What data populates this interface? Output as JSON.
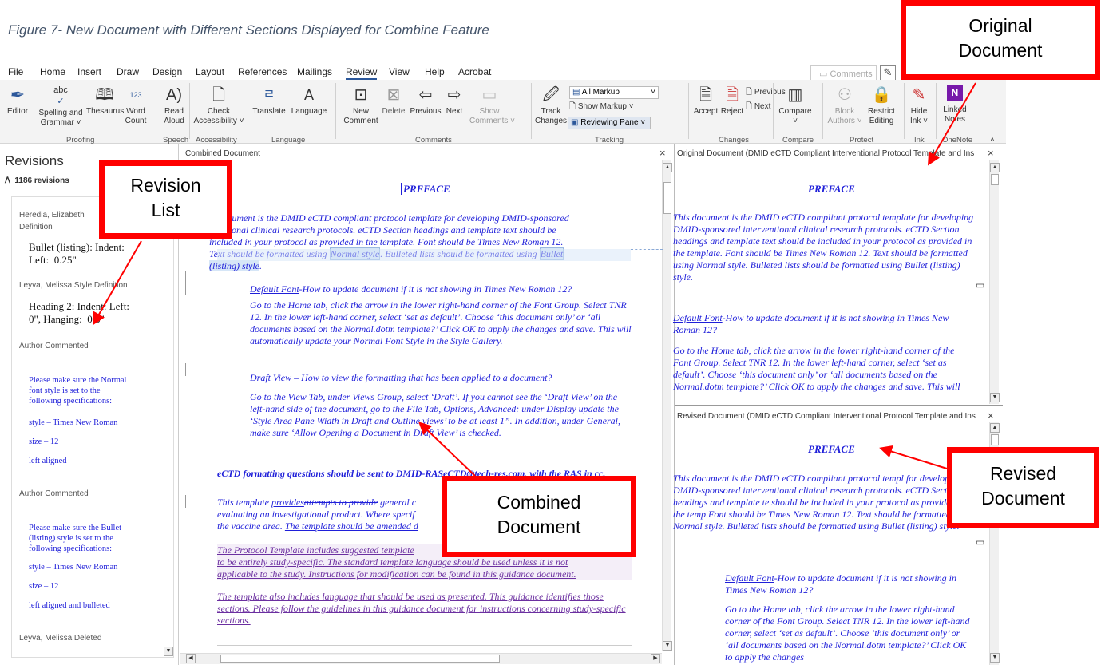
{
  "caption": "Figure 7- New Document with Different Sections Displayed for Combine Feature",
  "menu": [
    "File",
    "Home",
    "Insert",
    "Draw",
    "Design",
    "Layout",
    "References",
    "Mailings",
    "Review",
    "View",
    "Help",
    "Acrobat"
  ],
  "menu_active": "Review",
  "comments_button": "Comments",
  "ribbon": {
    "buttons": {
      "editor": "Editor",
      "spelling": "Spelling and\nGrammar ˅",
      "thesaurus": "Thesaurus",
      "wordcount": "Word\nCount",
      "readaloud": "Read\nAloud",
      "checkacc": "Check\nAccessibility ˅",
      "translate": "Translate",
      "language": "Language",
      "newcomment": "New\nComment",
      "delete": "Delete",
      "previous": "Previous",
      "next": "Next",
      "showcomments": "Show\nComments ˅",
      "track": "Track\nChanges ˅",
      "allmarkup": "All Markup",
      "showmarkup": "Show Markup ˅",
      "reviewingpane": "Reviewing Pane ˅",
      "accept": "Accept",
      "reject": "Reject",
      "chg_previous": "Previous",
      "chg_next": "Next",
      "compare": "Compare",
      "blockauthors": "Block\nAuthors ˅",
      "restrict": "Restrict\nEditing",
      "hideink": "Hide\nInk ˅",
      "linkednotes": "Linked\nNotes",
      "abc": "abc",
      "num123": "123"
    },
    "groups": [
      "Proofing",
      "Speech",
      "Accessibility",
      "Language",
      "Comments",
      "Tracking",
      "Changes",
      "Compare",
      "Protect",
      "Ink",
      "OneNote"
    ]
  },
  "revisions": {
    "title": "Revisions",
    "count": "1186 revisions",
    "items": [
      {
        "author": "Heredia, Elizabeth",
        "kind": "Definition",
        "detail": "Bullet (listing): Indent:\nLeft:  0.25\""
      },
      {
        "author": "Leyva, Melissa Style Definition",
        "detail": "Heading 2: Indent: Left:\n0\", Hanging:  0.5\""
      },
      {
        "author": "Author Commented",
        "lines": [
          "Please make sure the Normal\nfont style is set to the\nfollowing specifications:",
          "style – Times New Roman",
          "size – 12",
          "left aligned"
        ]
      },
      {
        "author": "Author Commented",
        "lines": [
          "Please make sure the Bullet\n(listing) style is set to the\nfollowing specifications:",
          "style – Times New Roman",
          "size – 12",
          "left aligned and bulleted"
        ]
      },
      {
        "author": "Leyva, Melissa Deleted"
      }
    ]
  },
  "combined": {
    "header": "Combined Document",
    "heading": "PREFACE",
    "p1_a": "is document is the DMID eCTD compliant protocol template for developing DMID-sponsored",
    "p1_b": "rventional clinical research protocols. eCTD Section headings and template text should be",
    "p1_c": "included in your protocol as provided in the template. Font should be Times New Roman 12.",
    "p1_d1": "Text should be formatted using ",
    "p1_d2": "Normal style",
    "p1_d3": ". Bulleted lists should be formatted using ",
    "p1_d4": "Bullet",
    "p1_e": "(listing) style",
    "p1_e2": ".",
    "sub1_link": "Default Font",
    "sub1": "-How to update document if it is not showing in Times New Roman 12?",
    "p2": "Go to the Home tab, click the arrow in the lower right-hand corner of the Font Group. Select TNR 12.  In the lower left-hand corner, select ‘set as default’.  Choose ‘this document only’ or ‘all documents based on the Normal.dotm template?’ Click OK to apply the changes and save.  This will automatically update your Normal Font Style in the Style Gallery.",
    "sub2_link": "Draft View",
    "sub2": " – How to view the formatting that has been applied to a document?",
    "p3": "Go to the View Tab, under Views Group, select ‘Draft’.  If you cannot see the ‘Draft View’ on the left-hand side of the document, go to the File Tab, Options, Advanced: under Display update the ‘Style Area Pane Width in Draft and Outline views’ to be at least 1”.  In addition, under General, make sure ‘Allow Opening a Document in Draft View’ is checked.",
    "bold": "eCTD formatting questions should be sent to DMID-RASeCTD@tech-res.com, with the RAS in cc.",
    "p4_a": "This template ",
    "p4_ins": "provides",
    "p4_del": "attempts to provide",
    "p4_b": " general c",
    "p4_c": "evaluating an investigational product. Where specif",
    "p4_d": "the vaccine area. ",
    "p4_e": "The template should be amended d",
    "p5_a": "The Protocol Template includes suggested template",
    "p5_b": "to be entirely study-specific.  The standard template language should be used unless it is not",
    "p5_c": "applicable to the study.  Instructions for modification can be found in this guidance document.",
    "p6": "The template also includes language that should be used as presented.  This guidance identifies those sections.  Please follow the guidelines in this guidance document for instructions concerning study-specific sections."
  },
  "original": {
    "header": "Original Document (DMID eCTD Compliant Interventional Protocol Template and Ins",
    "heading": "PREFACE",
    "p1": "This document is the DMID eCTD compliant protocol template for developing DMID-sponsored interventional clinical research protocols. eCTD Section headings and template text should be included in your protocol as provided in the template. Font should be Times New Roman 12.  Text should be formatted using Normal style. Bulleted lists should be formatted using Bullet (listing) style.",
    "sub_link": "Default Font",
    "sub": "-How to update document if it is not showing in Times New Roman 12?",
    "p2": " Go to the Home tab, click the arrow in the lower right-hand corner of the Font Group.  Select TNR 12.  In the lower left-hand corner, select ‘set as default’.  Choose ‘this document only’ or ‘all documents based on the Normal.dotm template?’ Click OK to apply the changes and save.  This will"
  },
  "revised": {
    "header": "Revised Document (DMID eCTD Compliant Interventional Protocol Template and Ins",
    "heading": "PREFACE",
    "p1": "This document is the DMID eCTD compliant protocol templ for developing DMID-sponsored interventional clinical research protocols. eCTD Section headings and template te should be included in your protocol as provided in the temp Font should be Times New Roman 12.  Text should be formatted using Normal style. Bulleted lists should be formatted using Bullet (listing) style.",
    "sub_link": "Default Font",
    "sub": "-How to update document if it is not showing in Times New Roman 12?",
    "p2": "Go to the Home tab, click the arrow in the lower right-hand corner of the Font Group.  Select TNR 12.  In the lower left-hand corner, select ‘set as default’.  Choose ‘this document only’ or ‘all documents based on the Normal.dotm template?’ Click OK to apply the changes"
  },
  "callouts": {
    "original": "Original\nDocument",
    "revision": "Revision\nList",
    "combined": "Combined\nDocument",
    "revised": "Revised\nDocument"
  },
  "colors": {
    "accent": "#2b579a",
    "doc_text": "#1f1fd9",
    "callout": "#ff0000"
  }
}
